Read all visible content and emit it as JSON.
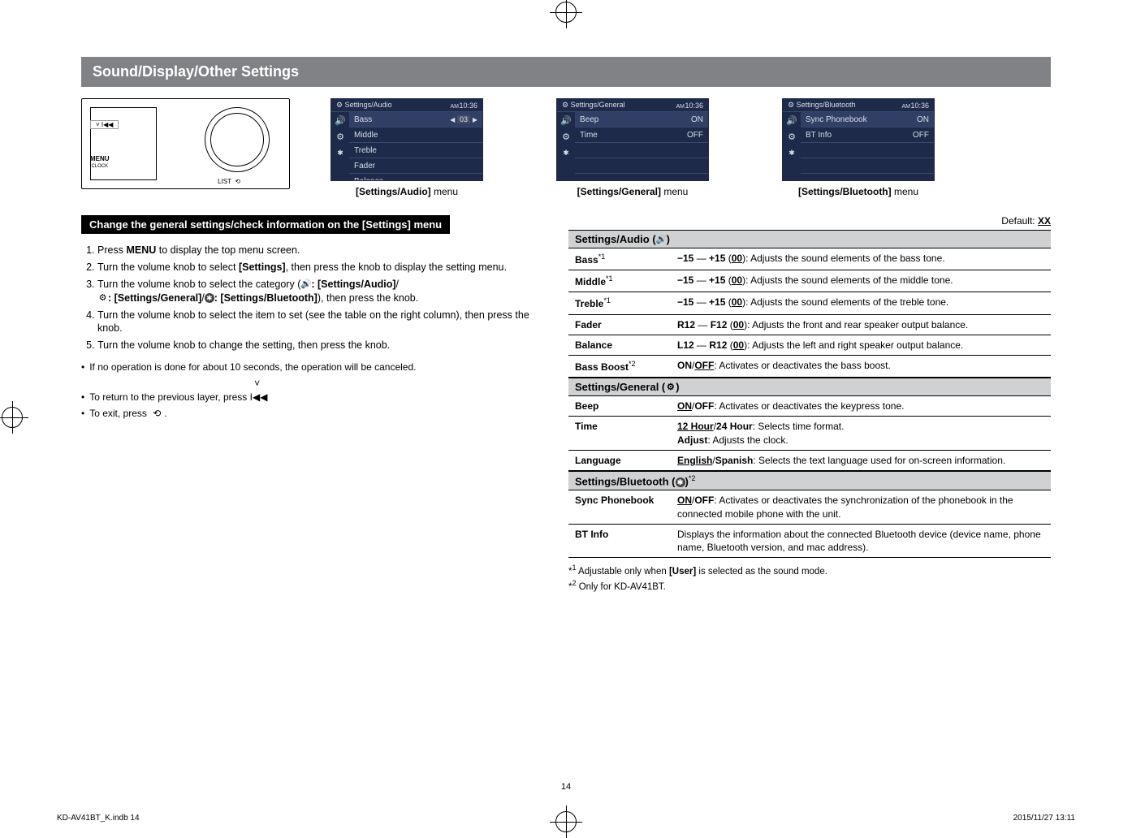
{
  "title": "Sound/Display/Other Settings",
  "screens": {
    "audio": {
      "header": "Settings/Audio",
      "time_ampm": "AM",
      "time": "10:36",
      "items": [
        "Bass",
        "Middle",
        "Treble",
        "Fader",
        "Balance"
      ],
      "selected_value": "03",
      "caption_before": "[Settings/Audio]",
      "caption_after": " menu"
    },
    "general": {
      "header": "Settings/General",
      "time_ampm": "AM",
      "time": "10:36",
      "items": [
        {
          "label": "Beep",
          "value": "ON"
        },
        {
          "label": "Time",
          "value": "OFF"
        }
      ],
      "caption_before": "[Settings/General]",
      "caption_after": " menu"
    },
    "bluetooth": {
      "header": "Settings/Bluetooth",
      "time_ampm": "AM",
      "time": "10:36",
      "items": [
        {
          "label": "Sync Phonebook",
          "value": "ON"
        },
        {
          "label": "BT Info",
          "value": "OFF"
        }
      ],
      "caption_before": "[Settings/Bluetooth]",
      "caption_after": " menu"
    }
  },
  "change_bar": "Change the general settings/check information on the [Settings] menu",
  "steps": {
    "s1a": "Press ",
    "s1b": "MENU",
    "s1c": " to display the top menu screen.",
    "s2a": "Turn the volume knob to select ",
    "s2b": "[Settings]",
    "s2c": ", then press the knob to display the setting menu.",
    "s3a": "Turn the volume knob to select the category (",
    "s3b": ": [Settings/Audio]",
    "s3c": "/",
    "s3d": ": [Settings/General]",
    "s3e": "/",
    "s3f": ": [Settings/Bluetooth]",
    "s3g": "), then press the knob.",
    "s4": "Turn the volume knob to select the item to set (see the table on the right column), then press the knob.",
    "s5": "Turn the volume knob to change the setting, then press the knob."
  },
  "notes": {
    "n1": "If no operation is done for about 10 seconds, the operation will be canceled.",
    "n2a": "To return to the previous layer, press ",
    "n2b": ".",
    "n3a": "To exit, press ",
    "n3b": "."
  },
  "default_label_a": "Default: ",
  "default_label_b": "XX",
  "section_headers": {
    "audio": "Settings/Audio (",
    "audio_end": ")",
    "general": "Settings/General (",
    "general_end": ")",
    "bluetooth_a": "Settings/Bluetooth (",
    "bluetooth_b": ")",
    "bluetooth_sup": "*2"
  },
  "table_audio": {
    "bass_key": "Bass",
    "bass_sup": "*1",
    "bass_val_a": "−15",
    "bass_val_dash": " — ",
    "bass_val_b": "+15",
    "bass_val_paren_open": " (",
    "bass_val_default": "00",
    "bass_val_close": "): Adjusts the sound elements of the bass tone.",
    "middle_key": "Middle",
    "middle_sup": "*1",
    "middle_val_a": "−15",
    "middle_val_b": "+15",
    "middle_default": "00",
    "middle_rest": "): Adjusts the sound elements of the middle tone.",
    "treble_key": "Treble",
    "treble_sup": "*1",
    "treble_val_a": "−15",
    "treble_val_b": "+15",
    "treble_default": "00",
    "treble_rest": "): Adjusts the sound elements of the treble tone.",
    "fader_key": "Fader",
    "fader_a": "R12",
    "fader_b": "F12",
    "fader_default": "00",
    "fader_rest": "): Adjusts the front and rear speaker output balance.",
    "balance_key": "Balance",
    "balance_a": "L12",
    "balance_b": "R12",
    "balance_default": "00",
    "balance_rest": "): Adjusts the left and right speaker output balance.",
    "bassboost_key": "Bass Boost",
    "bassboost_sup": "*2",
    "bassboost_on": "ON",
    "bassboost_off": "OFF",
    "bassboost_rest": ": Activates or deactivates the bass boost."
  },
  "table_general": {
    "beep_key": "Beep",
    "beep_on": "ON",
    "beep_off": "OFF",
    "beep_rest": ": Activates or deactivates the keypress tone.",
    "time_key": "Time",
    "time_a": "12 Hour",
    "time_b": "24 Hour",
    "time_rest1": ": Selects time format.",
    "time_adjust": "Adjust",
    "time_rest2": ": Adjusts the clock.",
    "lang_key": "Language",
    "lang_a": "English",
    "lang_b": "Spanish",
    "lang_rest": ": Selects the text language used for on-screen information."
  },
  "table_bt": {
    "sync_key": "Sync Phonebook",
    "sync_on": "ON",
    "sync_off": "OFF",
    "sync_rest": ": Activates or deactivates the synchronization of the phonebook in the connected mobile phone with the unit.",
    "btinfo_key": "BT Info",
    "btinfo_rest": "Displays the information about the connected Bluetooth device (device name, phone name, Bluetooth version, and mac address)."
  },
  "footnotes": {
    "f1_a": "*",
    "f1_sup": "1",
    "f1_text": " Adjustable only when ",
    "f1_user": "[User]",
    "f1_rest": " is selected as the sound mode.",
    "f2_a": "*",
    "f2_sup": "2",
    "f2_text": " Only for KD-AV41BT."
  },
  "page_number": "14",
  "footer_left": "KD-AV41BT_K.indb   14",
  "footer_right": "2015/11/27   13:11",
  "device_menu_label": "MENU",
  "device_clock_label": "CLOCK",
  "device_list_label": "LIST"
}
